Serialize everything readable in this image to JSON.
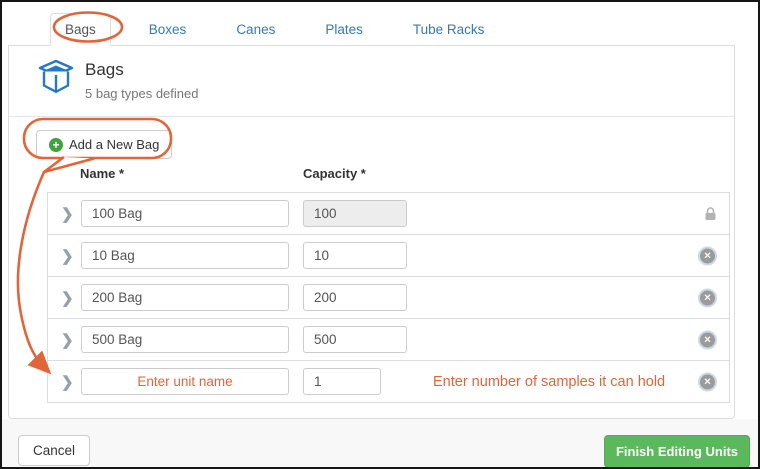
{
  "tabs": {
    "items": [
      {
        "label": "Bags",
        "active": true
      },
      {
        "label": "Boxes",
        "active": false
      },
      {
        "label": "Canes",
        "active": false
      },
      {
        "label": "Plates",
        "active": false
      },
      {
        "label": "Tube Racks",
        "active": false
      }
    ]
  },
  "header": {
    "icon": "open-box-icon",
    "title": "Bags",
    "subtitle": "5 bag types defined"
  },
  "toolbar": {
    "add_icon": "plus-circle-icon",
    "add_button_label": "Add a New Bag"
  },
  "table": {
    "columns": [
      "Name *",
      "Capacity *"
    ],
    "rows": [
      {
        "name": "100 Bag",
        "capacity": "100",
        "capacity_locked": true,
        "action_icon": "lock-icon"
      },
      {
        "name": "10 Bag",
        "capacity": "10",
        "capacity_locked": false,
        "action_icon": "remove-circle-icon"
      },
      {
        "name": "200 Bag",
        "capacity": "200",
        "capacity_locked": false,
        "action_icon": "remove-circle-icon"
      },
      {
        "name": "500 Bag",
        "capacity": "500",
        "capacity_locked": false,
        "action_icon": "remove-circle-icon"
      },
      {
        "name": "",
        "name_placeholder": "Enter unit name",
        "capacity": "1",
        "hint": "Enter number of samples it can hold",
        "capacity_locked": false,
        "action_icon": "remove-circle-icon"
      }
    ],
    "expand_icon": "chevron-right-icon"
  },
  "footer": {
    "cancel_label": "Cancel",
    "finish_label": "Finish Editing Units"
  },
  "colors": {
    "annotation_orange": "#e2653a",
    "link_blue": "#337ab7",
    "button_green": "#5cb85c",
    "icon_blue": "#2478c8",
    "plus_green": "#3fa33f"
  }
}
